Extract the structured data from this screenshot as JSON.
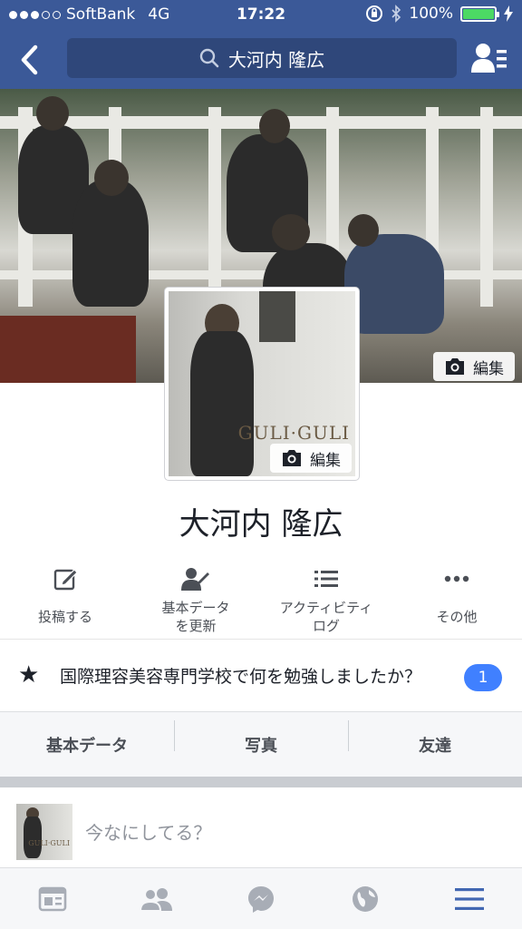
{
  "status_bar": {
    "carrier": "SoftBank",
    "network": "4G",
    "time": "17:22",
    "battery": "100%",
    "battery_level": 1.0
  },
  "header": {
    "search_text": "大河内 隆広",
    "back_icon": "chevron-left-icon",
    "friend_requests_icon": "friend-requests-icon"
  },
  "cover": {
    "edit_label": "編集"
  },
  "profile": {
    "edit_label": "編集",
    "name": "大河内 隆広"
  },
  "actions": [
    {
      "label": "投稿する",
      "icon": "compose-icon"
    },
    {
      "label": "基本データを更新",
      "icon": "edit-profile-icon"
    },
    {
      "label": "アクティビティログ",
      "icon": "list-icon"
    },
    {
      "label": "その他",
      "icon": "more-icon"
    }
  ],
  "question": {
    "text": "国際理容美容専門学校で何を勉強しましたか？",
    "count": "1"
  },
  "tabs": [
    "基本データ",
    "写真",
    "友達"
  ],
  "composer": {
    "placeholder": "今なにしてる？"
  },
  "bottom_tabs": [
    "news-feed-icon",
    "friends-icon",
    "messenger-icon",
    "globe-icon",
    "menu-icon"
  ],
  "colors": {
    "brand": "#3b5998",
    "badge": "#4080ff",
    "battery": "#4cd964",
    "tab_active": "#4267b2"
  }
}
